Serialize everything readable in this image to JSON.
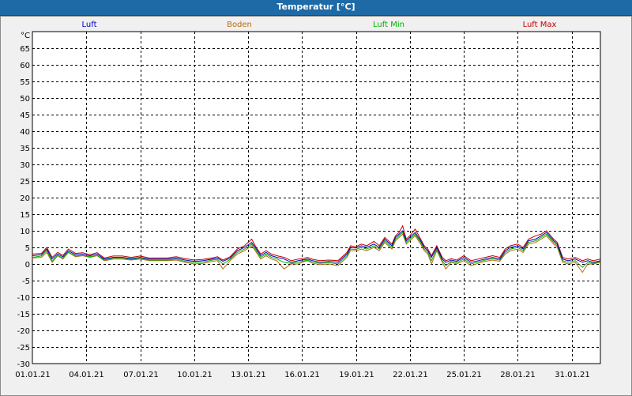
{
  "window": {
    "title": "Temperatur [°C]"
  },
  "chart_data": {
    "type": "line",
    "title": "Temperatur [°C]",
    "ylabel": "°C",
    "xlabel": "",
    "ylim": [
      -30,
      70
    ],
    "yticks": [
      65,
      60,
      55,
      50,
      45,
      40,
      35,
      30,
      25,
      20,
      15,
      10,
      5,
      0,
      -5,
      -10,
      -15,
      -20,
      -25,
      -30
    ],
    "x_tick_labels": [
      "01.01.21",
      "04.01.21",
      "07.01.21",
      "10.01.21",
      "13.01.21",
      "16.01.21",
      "19.01.21",
      "22.01.21",
      "25.01.21",
      "28.01.21",
      "31.01.21"
    ],
    "x_tick_days": [
      0,
      3,
      6,
      9,
      12,
      15,
      18,
      21,
      24,
      27,
      30
    ],
    "xlim_days": [
      0,
      31.6
    ],
    "grid": true,
    "legend_position": "top",
    "series": [
      {
        "name": "Luft",
        "color": "#0000c0",
        "x": [
          0,
          0.5,
          0.8,
          1.1,
          1.4,
          1.7,
          2.0,
          2.4,
          2.8,
          3.2,
          3.6,
          4.0,
          4.5,
          5.0,
          5.5,
          6.0,
          6.5,
          7.0,
          7.5,
          8.0,
          8.5,
          9.0,
          9.5,
          10.0,
          10.3,
          10.6,
          11.0,
          11.4,
          11.8,
          12.2,
          12.4,
          12.7,
          13.0,
          13.3,
          13.6,
          14.0,
          14.4,
          14.8,
          15.0,
          15.3,
          15.6,
          16.0,
          16.5,
          17.0,
          17.5,
          17.7,
          18.0,
          18.3,
          18.6,
          19.0,
          19.3,
          19.6,
          20.0,
          20.2,
          20.4,
          20.6,
          20.8,
          21.0,
          21.3,
          21.6,
          21.8,
          22.0,
          22.2,
          22.5,
          22.8,
          23.0,
          23.3,
          23.6,
          24.0,
          24.4,
          24.8,
          25.2,
          25.6,
          26.0,
          26.3,
          26.6,
          27.0,
          27.3,
          27.6,
          28.0,
          28.3,
          28.6,
          29.0,
          29.2,
          29.5,
          29.8,
          30.2,
          30.6,
          30.9,
          31.2,
          31.6
        ],
        "y": [
          2.5,
          2.8,
          4.5,
          1.5,
          3.0,
          2.2,
          4.0,
          2.8,
          3.0,
          2.5,
          3.0,
          1.5,
          2.0,
          2.0,
          1.6,
          2.0,
          1.5,
          1.5,
          1.5,
          1.8,
          1.2,
          0.8,
          1.0,
          1.5,
          1.8,
          0.8,
          1.8,
          4.0,
          5.0,
          6.5,
          5.0,
          2.5,
          3.5,
          2.5,
          2.0,
          1.5,
          0.5,
          1.0,
          1.2,
          1.5,
          1.0,
          0.5,
          0.8,
          0.5,
          3.0,
          5.0,
          4.8,
          5.5,
          5.0,
          6.0,
          5.0,
          7.5,
          5.5,
          8.0,
          9.0,
          10.0,
          7.0,
          8.0,
          9.5,
          7.0,
          5.0,
          4.0,
          2.0,
          5.0,
          1.5,
          0.5,
          1.2,
          0.8,
          2.0,
          0.5,
          1.0,
          1.5,
          2.0,
          1.5,
          4.0,
          5.0,
          5.5,
          4.5,
          7.0,
          7.5,
          8.5,
          9.5,
          7.0,
          6.0,
          1.5,
          1.0,
          1.5,
          0.5,
          1.0,
          0.5,
          1.0
        ]
      },
      {
        "name": "Boden",
        "color": "#b86a10",
        "x": [
          0,
          0.5,
          0.8,
          1.1,
          1.4,
          1.7,
          2.0,
          2.4,
          2.8,
          3.2,
          3.6,
          4.0,
          4.5,
          5.0,
          5.5,
          6.0,
          6.5,
          7.0,
          7.5,
          8.0,
          8.5,
          9.0,
          9.5,
          10.0,
          10.3,
          10.6,
          11.0,
          11.4,
          11.8,
          12.2,
          12.4,
          12.7,
          13.0,
          13.3,
          13.6,
          14.0,
          14.4,
          14.8,
          15.0,
          15.3,
          15.6,
          16.0,
          16.5,
          17.0,
          17.5,
          17.7,
          18.0,
          18.3,
          18.6,
          19.0,
          19.3,
          19.6,
          20.0,
          20.2,
          20.4,
          20.6,
          20.8,
          21.0,
          21.3,
          21.6,
          21.8,
          22.0,
          22.2,
          22.5,
          22.8,
          23.0,
          23.3,
          23.6,
          24.0,
          24.4,
          24.8,
          25.2,
          25.6,
          26.0,
          26.3,
          26.6,
          27.0,
          27.3,
          27.6,
          28.0,
          28.3,
          28.6,
          29.0,
          29.2,
          29.5,
          29.8,
          30.2,
          30.6,
          30.9,
          31.2,
          31.6
        ],
        "y": [
          1.8,
          2.0,
          3.5,
          0.5,
          2.5,
          1.5,
          3.5,
          2.2,
          2.5,
          2.0,
          2.5,
          1.0,
          1.5,
          1.5,
          1.2,
          1.5,
          1.0,
          1.0,
          1.0,
          1.2,
          0.5,
          0.0,
          0.2,
          0.8,
          1.0,
          -1.5,
          1.0,
          3.0,
          4.0,
          5.5,
          4.0,
          1.5,
          2.5,
          1.5,
          1.0,
          -1.5,
          0.0,
          0.0,
          0.5,
          1.0,
          0.2,
          -0.2,
          0.0,
          -0.5,
          2.0,
          4.0,
          4.0,
          4.5,
          4.0,
          5.0,
          4.0,
          6.5,
          4.5,
          7.0,
          8.0,
          9.0,
          6.0,
          7.0,
          8.5,
          6.0,
          4.0,
          3.0,
          0.0,
          4.0,
          0.5,
          -1.5,
          0.5,
          0.0,
          1.0,
          -0.5,
          0.2,
          0.8,
          1.2,
          0.8,
          3.0,
          4.0,
          4.5,
          3.5,
          6.0,
          6.5,
          7.5,
          8.5,
          6.0,
          5.0,
          0.5,
          0.0,
          0.5,
          -2.5,
          0.0,
          0.0,
          0.5
        ]
      },
      {
        "name": "Luft Min",
        "color": "#00b000",
        "x": [
          0,
          0.5,
          0.8,
          1.1,
          1.4,
          1.7,
          2.0,
          2.4,
          2.8,
          3.2,
          3.6,
          4.0,
          4.5,
          5.0,
          5.5,
          6.0,
          6.5,
          7.0,
          7.5,
          8.0,
          8.5,
          9.0,
          9.5,
          10.0,
          10.3,
          10.6,
          11.0,
          11.4,
          11.8,
          12.2,
          12.4,
          12.7,
          13.0,
          13.3,
          13.6,
          14.0,
          14.4,
          14.8,
          15.0,
          15.3,
          15.6,
          16.0,
          16.5,
          17.0,
          17.5,
          17.7,
          18.0,
          18.3,
          18.6,
          19.0,
          19.3,
          19.6,
          20.0,
          20.2,
          20.4,
          20.6,
          20.8,
          21.0,
          21.3,
          21.6,
          21.8,
          22.0,
          22.2,
          22.5,
          22.8,
          23.0,
          23.3,
          23.6,
          24.0,
          24.4,
          24.8,
          25.2,
          25.6,
          26.0,
          26.3,
          26.6,
          27.0,
          27.3,
          27.6,
          28.0,
          28.3,
          28.6,
          29.0,
          29.2,
          29.5,
          29.8,
          30.2,
          30.6,
          30.9,
          31.2,
          31.6
        ],
        "y": [
          2.0,
          2.4,
          4.0,
          0.8,
          2.6,
          1.8,
          3.6,
          2.4,
          2.6,
          2.2,
          2.6,
          1.2,
          1.8,
          1.8,
          1.4,
          1.8,
          1.2,
          1.2,
          1.2,
          1.5,
          0.8,
          0.4,
          0.6,
          1.2,
          1.4,
          0.0,
          1.4,
          3.5,
          4.5,
          6.0,
          4.5,
          2.0,
          3.0,
          2.0,
          1.5,
          0.5,
          0.2,
          0.5,
          0.8,
          1.2,
          0.6,
          0.2,
          0.4,
          0.0,
          2.5,
          4.5,
          4.4,
          5.0,
          4.5,
          5.5,
          4.5,
          7.0,
          5.0,
          7.5,
          8.5,
          9.5,
          6.5,
          7.5,
          9.0,
          6.5,
          4.5,
          3.5,
          1.0,
          4.5,
          1.0,
          -0.5,
          0.8,
          0.4,
          1.5,
          0.0,
          0.6,
          1.2,
          1.6,
          1.2,
          3.5,
          4.5,
          5.0,
          4.0,
          6.5,
          7.0,
          8.0,
          9.0,
          6.5,
          5.5,
          1.0,
          0.5,
          1.0,
          -1.0,
          0.5,
          0.2,
          0.8
        ]
      },
      {
        "name": "Luft Max",
        "color": "#c00000",
        "x": [
          0,
          0.5,
          0.8,
          1.1,
          1.4,
          1.7,
          2.0,
          2.4,
          2.8,
          3.2,
          3.6,
          4.0,
          4.5,
          5.0,
          5.5,
          6.0,
          6.5,
          7.0,
          7.5,
          8.0,
          8.5,
          9.0,
          9.5,
          10.0,
          10.3,
          10.6,
          11.0,
          11.4,
          11.8,
          12.2,
          12.4,
          12.7,
          13.0,
          13.3,
          13.6,
          14.0,
          14.4,
          14.8,
          15.0,
          15.3,
          15.6,
          16.0,
          16.5,
          17.0,
          17.5,
          17.7,
          18.0,
          18.3,
          18.6,
          19.0,
          19.3,
          19.6,
          20.0,
          20.2,
          20.4,
          20.6,
          20.8,
          21.0,
          21.3,
          21.6,
          21.8,
          22.0,
          22.2,
          22.5,
          22.8,
          23.0,
          23.3,
          23.6,
          24.0,
          24.4,
          24.8,
          25.2,
          25.6,
          26.0,
          26.3,
          26.6,
          27.0,
          27.3,
          27.6,
          28.0,
          28.3,
          28.6,
          29.0,
          29.2,
          29.5,
          29.8,
          30.2,
          30.6,
          30.9,
          31.2,
          31.6
        ],
        "y": [
          3.0,
          3.2,
          5.0,
          2.0,
          3.5,
          2.6,
          4.5,
          3.2,
          3.4,
          2.8,
          3.4,
          1.8,
          2.4,
          2.4,
          2.0,
          2.4,
          1.8,
          1.8,
          1.8,
          2.2,
          1.6,
          1.2,
          1.4,
          1.8,
          2.2,
          1.2,
          2.2,
          4.5,
          5.5,
          7.5,
          5.5,
          3.0,
          4.0,
          3.0,
          2.5,
          2.0,
          1.0,
          1.5,
          1.6,
          2.0,
          1.4,
          1.0,
          1.2,
          1.0,
          3.5,
          5.5,
          5.2,
          6.0,
          5.5,
          6.8,
          5.5,
          8.0,
          6.0,
          8.5,
          9.5,
          11.5,
          7.5,
          8.5,
          10.5,
          7.5,
          5.5,
          4.5,
          2.5,
          5.5,
          2.0,
          1.0,
          1.6,
          1.2,
          2.5,
          1.0,
          1.5,
          2.0,
          2.5,
          2.0,
          4.5,
          5.5,
          6.0,
          5.0,
          7.5,
          8.5,
          9.0,
          10.0,
          7.5,
          6.5,
          2.0,
          1.5,
          2.0,
          1.0,
          1.5,
          1.0,
          1.5
        ]
      }
    ]
  }
}
